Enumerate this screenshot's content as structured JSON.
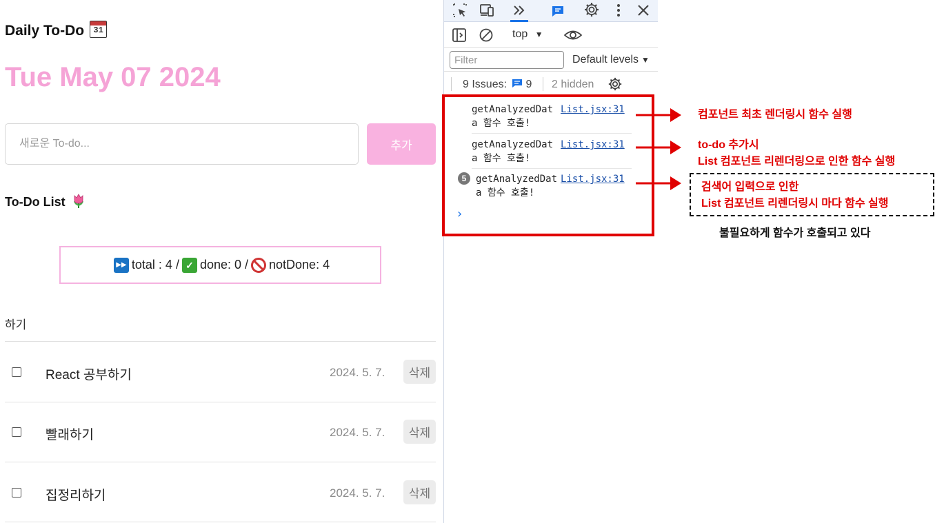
{
  "app": {
    "title": "Daily To-Do",
    "calendar_icon_text": "31",
    "date": "Tue May 07 2024",
    "input_placeholder": "새로운 To-do...",
    "add_button": "추가",
    "list_title": "To-Do List",
    "stats": {
      "total_label": "total : 4 /",
      "done_label": "done: 0 /",
      "notdone_label": "notDone: 4"
    },
    "search_fragment": "하기",
    "todos": [
      {
        "text": "React 공부하기",
        "date": "2024. 5. 7.",
        "delete": "삭제",
        "done": false
      },
      {
        "text": "빨래하기",
        "date": "2024. 5. 7.",
        "delete": "삭제",
        "done": false
      },
      {
        "text": "집정리하기",
        "date": "2024. 5. 7.",
        "delete": "삭제",
        "done": false
      }
    ]
  },
  "devtools": {
    "context": "top",
    "filter_placeholder": "Filter",
    "levels": "Default levels",
    "issues_label": "9 Issues:",
    "issues_count": "9",
    "hidden": "2 hidden",
    "logs": [
      {
        "message": "getAnalyzedData 함수 호출!",
        "source": "List.jsx:31"
      },
      {
        "message": "getAnalyzedData 함수 호출!",
        "source": "List.jsx:31"
      },
      {
        "message": "getAnalyzedData 함수 호출!",
        "source": "List.jsx:31",
        "repeat": "5"
      }
    ],
    "prompt": "›"
  },
  "annotations": {
    "note1": "컴포넌트 최초 렌더링시 함수 실행",
    "note2_line1": "to-do 추가시",
    "note2_line2": "List 컴포넌트 리렌더링으로 인한 함수 실행",
    "note3_line1": "검색어 입력으로 인한",
    "note3_line2": "List 컴포넌트 리렌더링시 마다 함수 실행",
    "summary": "불필요하게 함수가 호출되고 있다",
    "color": "#e00000"
  }
}
